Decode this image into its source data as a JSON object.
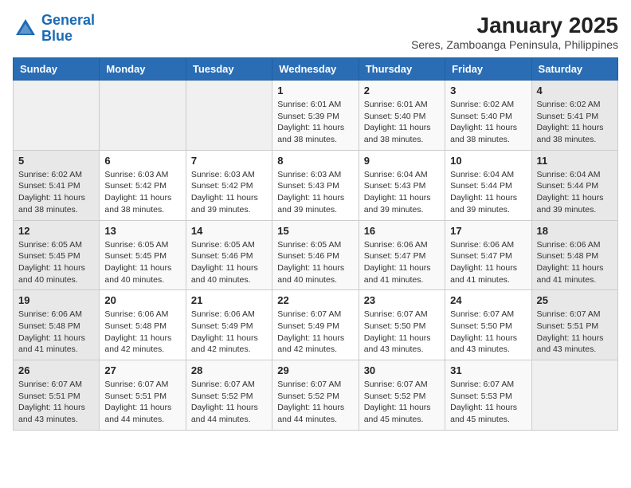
{
  "logo": {
    "line1": "General",
    "line2": "Blue"
  },
  "title": "January 2025",
  "subtitle": "Seres, Zamboanga Peninsula, Philippines",
  "weekdays": [
    "Sunday",
    "Monday",
    "Tuesday",
    "Wednesday",
    "Thursday",
    "Friday",
    "Saturday"
  ],
  "weeks": [
    [
      {
        "day": "",
        "info": ""
      },
      {
        "day": "",
        "info": ""
      },
      {
        "day": "",
        "info": ""
      },
      {
        "day": "1",
        "info": "Sunrise: 6:01 AM\nSunset: 5:39 PM\nDaylight: 11 hours\nand 38 minutes."
      },
      {
        "day": "2",
        "info": "Sunrise: 6:01 AM\nSunset: 5:40 PM\nDaylight: 11 hours\nand 38 minutes."
      },
      {
        "day": "3",
        "info": "Sunrise: 6:02 AM\nSunset: 5:40 PM\nDaylight: 11 hours\nand 38 minutes."
      },
      {
        "day": "4",
        "info": "Sunrise: 6:02 AM\nSunset: 5:41 PM\nDaylight: 11 hours\nand 38 minutes."
      }
    ],
    [
      {
        "day": "5",
        "info": "Sunrise: 6:02 AM\nSunset: 5:41 PM\nDaylight: 11 hours\nand 38 minutes."
      },
      {
        "day": "6",
        "info": "Sunrise: 6:03 AM\nSunset: 5:42 PM\nDaylight: 11 hours\nand 38 minutes."
      },
      {
        "day": "7",
        "info": "Sunrise: 6:03 AM\nSunset: 5:42 PM\nDaylight: 11 hours\nand 39 minutes."
      },
      {
        "day": "8",
        "info": "Sunrise: 6:03 AM\nSunset: 5:43 PM\nDaylight: 11 hours\nand 39 minutes."
      },
      {
        "day": "9",
        "info": "Sunrise: 6:04 AM\nSunset: 5:43 PM\nDaylight: 11 hours\nand 39 minutes."
      },
      {
        "day": "10",
        "info": "Sunrise: 6:04 AM\nSunset: 5:44 PM\nDaylight: 11 hours\nand 39 minutes."
      },
      {
        "day": "11",
        "info": "Sunrise: 6:04 AM\nSunset: 5:44 PM\nDaylight: 11 hours\nand 39 minutes."
      }
    ],
    [
      {
        "day": "12",
        "info": "Sunrise: 6:05 AM\nSunset: 5:45 PM\nDaylight: 11 hours\nand 40 minutes."
      },
      {
        "day": "13",
        "info": "Sunrise: 6:05 AM\nSunset: 5:45 PM\nDaylight: 11 hours\nand 40 minutes."
      },
      {
        "day": "14",
        "info": "Sunrise: 6:05 AM\nSunset: 5:46 PM\nDaylight: 11 hours\nand 40 minutes."
      },
      {
        "day": "15",
        "info": "Sunrise: 6:05 AM\nSunset: 5:46 PM\nDaylight: 11 hours\nand 40 minutes."
      },
      {
        "day": "16",
        "info": "Sunrise: 6:06 AM\nSunset: 5:47 PM\nDaylight: 11 hours\nand 41 minutes."
      },
      {
        "day": "17",
        "info": "Sunrise: 6:06 AM\nSunset: 5:47 PM\nDaylight: 11 hours\nand 41 minutes."
      },
      {
        "day": "18",
        "info": "Sunrise: 6:06 AM\nSunset: 5:48 PM\nDaylight: 11 hours\nand 41 minutes."
      }
    ],
    [
      {
        "day": "19",
        "info": "Sunrise: 6:06 AM\nSunset: 5:48 PM\nDaylight: 11 hours\nand 41 minutes."
      },
      {
        "day": "20",
        "info": "Sunrise: 6:06 AM\nSunset: 5:48 PM\nDaylight: 11 hours\nand 42 minutes."
      },
      {
        "day": "21",
        "info": "Sunrise: 6:06 AM\nSunset: 5:49 PM\nDaylight: 11 hours\nand 42 minutes."
      },
      {
        "day": "22",
        "info": "Sunrise: 6:07 AM\nSunset: 5:49 PM\nDaylight: 11 hours\nand 42 minutes."
      },
      {
        "day": "23",
        "info": "Sunrise: 6:07 AM\nSunset: 5:50 PM\nDaylight: 11 hours\nand 43 minutes."
      },
      {
        "day": "24",
        "info": "Sunrise: 6:07 AM\nSunset: 5:50 PM\nDaylight: 11 hours\nand 43 minutes."
      },
      {
        "day": "25",
        "info": "Sunrise: 6:07 AM\nSunset: 5:51 PM\nDaylight: 11 hours\nand 43 minutes."
      }
    ],
    [
      {
        "day": "26",
        "info": "Sunrise: 6:07 AM\nSunset: 5:51 PM\nDaylight: 11 hours\nand 43 minutes."
      },
      {
        "day": "27",
        "info": "Sunrise: 6:07 AM\nSunset: 5:51 PM\nDaylight: 11 hours\nand 44 minutes."
      },
      {
        "day": "28",
        "info": "Sunrise: 6:07 AM\nSunset: 5:52 PM\nDaylight: 11 hours\nand 44 minutes."
      },
      {
        "day": "29",
        "info": "Sunrise: 6:07 AM\nSunset: 5:52 PM\nDaylight: 11 hours\nand 44 minutes."
      },
      {
        "day": "30",
        "info": "Sunrise: 6:07 AM\nSunset: 5:52 PM\nDaylight: 11 hours\nand 45 minutes."
      },
      {
        "day": "31",
        "info": "Sunrise: 6:07 AM\nSunset: 5:53 PM\nDaylight: 11 hours\nand 45 minutes."
      },
      {
        "day": "",
        "info": ""
      }
    ]
  ]
}
